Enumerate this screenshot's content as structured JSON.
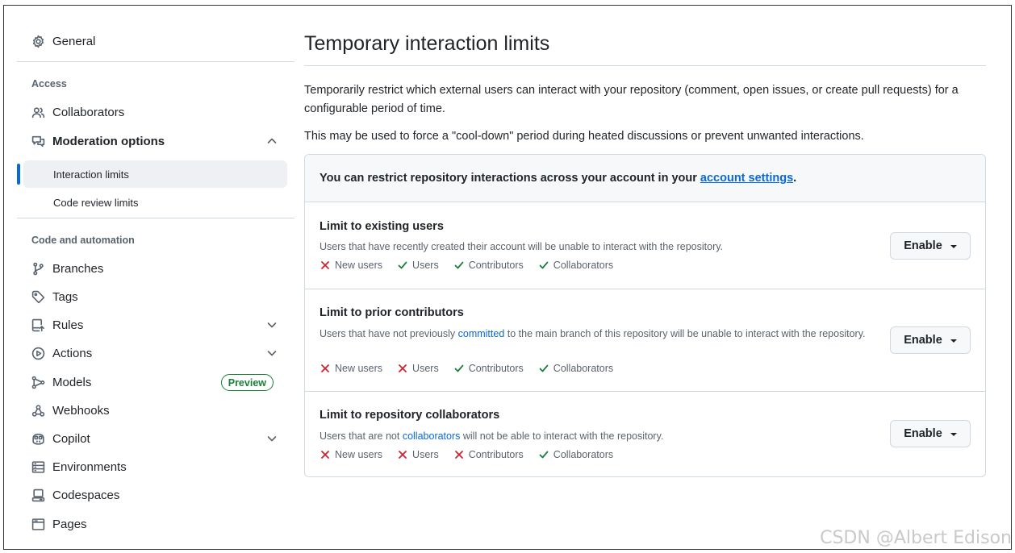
{
  "sidebar": {
    "general": {
      "label": "General",
      "icon": "gear-icon"
    },
    "access_section": "Access",
    "collaborators": {
      "label": "Collaborators",
      "icon": "people-icon"
    },
    "moderation": {
      "label": "Moderation options",
      "icon": "comment-discussion-icon",
      "expanded": true
    },
    "interaction_limits": {
      "label": "Interaction limits",
      "active": true
    },
    "code_review_limits": {
      "label": "Code review limits"
    },
    "code_automation_section": "Code and automation",
    "branches": {
      "label": "Branches",
      "icon": "git-branch-icon"
    },
    "tags": {
      "label": "Tags",
      "icon": "tag-icon"
    },
    "rules": {
      "label": "Rules",
      "icon": "repo-push-icon"
    },
    "actions": {
      "label": "Actions",
      "icon": "play-icon"
    },
    "models": {
      "label": "Models",
      "icon": "workflow-icon",
      "badge": "Preview"
    },
    "webhooks": {
      "label": "Webhooks",
      "icon": "webhook-icon"
    },
    "copilot": {
      "label": "Copilot",
      "icon": "copilot-icon"
    },
    "environments": {
      "label": "Environments",
      "icon": "server-icon"
    },
    "codespaces": {
      "label": "Codespaces",
      "icon": "codespaces-icon"
    },
    "pages": {
      "label": "Pages",
      "icon": "browser-icon"
    }
  },
  "main": {
    "title": "Temporary interaction limits",
    "intro1": "Temporarily restrict which external users can interact with your repository (comment, open issues, or create pull requests) for a configurable period of time.",
    "intro2": "This may be used to force a \"cool-down\" period during heated discussions or prevent unwanted interactions.",
    "notice_prefix": "You can restrict repository interactions across your account in your ",
    "notice_link": "account settings",
    "notice_suffix": ".",
    "limits": [
      {
        "title": "Limit to existing users",
        "desc": "Users that have recently created their account will be unable to interact with the repository.",
        "button": "Enable",
        "perms": [
          {
            "label": "New users",
            "allowed": false
          },
          {
            "label": "Users",
            "allowed": true
          },
          {
            "label": "Contributors",
            "allowed": true
          },
          {
            "label": "Collaborators",
            "allowed": true
          }
        ]
      },
      {
        "title": "Limit to prior contributors",
        "desc_prefix": "Users that have not previously ",
        "desc_link": "committed",
        "desc_suffix": " to the main branch of this repository will be unable to interact with the repository.",
        "button": "Enable",
        "perms": [
          {
            "label": "New users",
            "allowed": false
          },
          {
            "label": "Users",
            "allowed": false
          },
          {
            "label": "Contributors",
            "allowed": true
          },
          {
            "label": "Collaborators",
            "allowed": true
          }
        ]
      },
      {
        "title": "Limit to repository collaborators",
        "desc_prefix": "Users that are not ",
        "desc_link": "collaborators",
        "desc_suffix": " will not be able to interact with the repository.",
        "button": "Enable",
        "perms": [
          {
            "label": "New users",
            "allowed": false
          },
          {
            "label": "Users",
            "allowed": false
          },
          {
            "label": "Contributors",
            "allowed": false
          },
          {
            "label": "Collaborators",
            "allowed": true
          }
        ]
      }
    ]
  },
  "watermark": "CSDN @Albert Edison",
  "colors": {
    "accent": "#0969da",
    "success": "#1a7f37",
    "danger": "#cf222e"
  }
}
